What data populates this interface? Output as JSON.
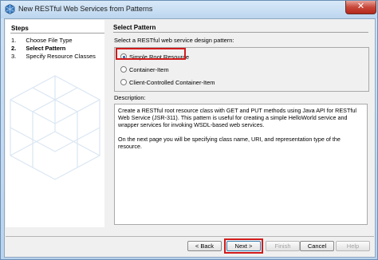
{
  "window": {
    "title": "New RESTful Web Services from Patterns",
    "close_glyph": "✕"
  },
  "steps": {
    "header": "Steps",
    "items": [
      {
        "number": "1.",
        "label": "Choose File Type",
        "current": false
      },
      {
        "number": "2.",
        "label": "Select Pattern",
        "current": true
      },
      {
        "number": "3.",
        "label": "Specify Resource Classes",
        "current": false
      }
    ]
  },
  "main": {
    "title": "Select Pattern",
    "prompt": "Select a RESTful web service design pattern:",
    "options": [
      {
        "label": "Simple Root Resource",
        "selected": true
      },
      {
        "label": "Container-Item",
        "selected": false
      },
      {
        "label": "Client-Controlled Container-Item",
        "selected": false
      }
    ],
    "description_label": "Description:",
    "description_paragraphs": [
      "Create a RESTful root resource class with GET and PUT methods using Java API for RESTful Web Service (JSR-311). This pattern is useful for creating a simple HelloWorld service and wrapper services for invoking WSDL-based web services.",
      "On the next page you will be specifying class name, URI, and representation type of the resource."
    ]
  },
  "buttons": {
    "back": "< Back",
    "next": "Next >",
    "finish": "Finish",
    "cancel": "Cancel",
    "help": "Help"
  },
  "colors": {
    "highlight": "#d11b1b",
    "title_bar": "#bcd6ef"
  }
}
